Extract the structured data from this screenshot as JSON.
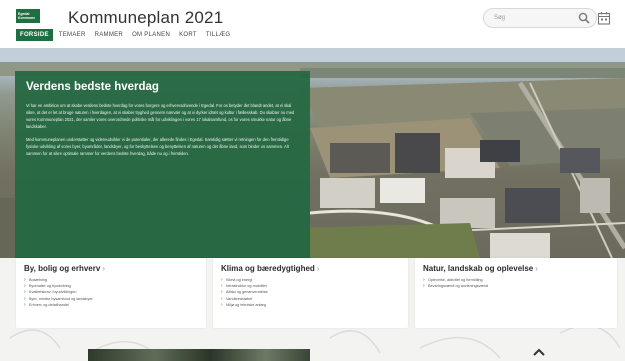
{
  "header": {
    "logo_text": "Egedal Kommune",
    "title": "Kommuneplan 2021",
    "search_placeholder": "Søg",
    "nav": [
      "FORSIDE",
      "TEMAER",
      "RAMMER",
      "OM PLANEN",
      "KORT",
      "TILLÆG"
    ]
  },
  "hero": {
    "title": "Verdens bedste hverdag",
    "paragraph1": "Vi har en ambition om at skabe verdens bedste hverdag for vores borgere og erhvervsdrivende i Egedal. For os betyder det blandt andet, at vi skal sikre, at det er let at bruge naturen i hverdagen, at vi skaber tryghed gennem nærvær og at vi dyrker idræt og kultur i fællesskab. Du skabter nu med vores Kommuneplan 2021, der samler vores overordnede politiske mål for udviklingen i vores 17 lokalsamfund, os for vores smukke natur og åbne landskaber.",
    "paragraph2": "Med kommuneplanen understøtter og videreudvikler vi de potentialer, der allerede findes i Egedal. Samtidig sætter vi retningen for den fremtidige fysiske udvikling af vores byer, byområder, landsbyer, og for beskyttelsen og benyttelsen af naturen og det åbne land, som binder os sammen. Alt sammen for at sikre optimale rammer for verdens bedste hverdag, både nu og i fremtiden."
  },
  "cards": [
    {
      "title": "By, bolig og erhverv",
      "chevron": "›",
      "items": [
        "Bosætning",
        "Byomalse og byudvikling",
        "Kvalitetskrav i byudviklingen",
        "Byer, mindre bysamfund og landsbyer",
        "Erhverv og detailhandel"
      ]
    },
    {
      "title": "Klima og bæredygtighed",
      "chevron": "›",
      "items": [
        "Klima og energi",
        "Infrastruktur og mobilitet",
        "Affald og genanvendelse",
        "Vandkredsløbet",
        "Miljø og tekniske anlæg"
      ]
    },
    {
      "title": "Natur, landskab og oplevelse",
      "chevron": "›",
      "items": [
        "Oplevelse, aktivitet og formidling",
        "Bevaringsværdi og anvisningsværdi"
      ]
    }
  ],
  "icons": {
    "search": "search-icon",
    "calendar": "calendar-icon",
    "up": "chevron-up-icon"
  },
  "colors": {
    "brand_green": "#1f6e42",
    "hero_card": "#246842"
  }
}
